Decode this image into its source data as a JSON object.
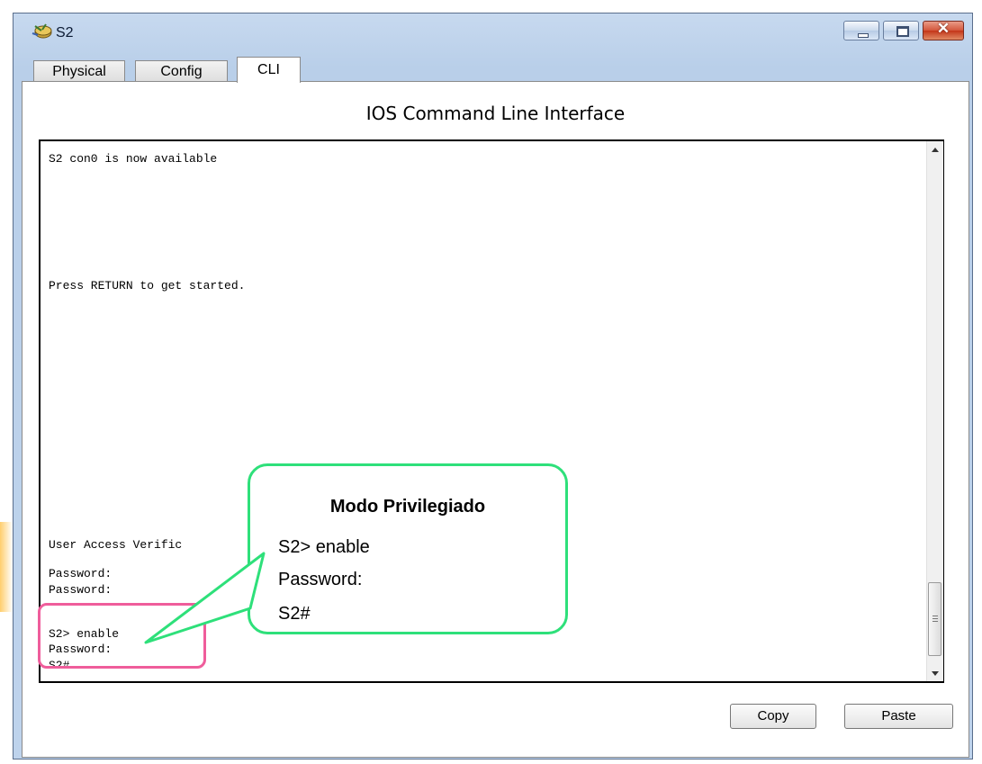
{
  "window": {
    "title": "S2",
    "icon": "router-device-icon",
    "controls": [
      "minimize-icon",
      "maximize-icon",
      "close-icon"
    ],
    "close_glyph": "✕"
  },
  "tabs": [
    {
      "label": "Physical",
      "active": false
    },
    {
      "label": "Config",
      "active": false
    },
    {
      "label": "CLI",
      "active": true
    }
  ],
  "panel": {
    "heading": "IOS Command Line Interface"
  },
  "cli": {
    "lines": [
      "S2 con0 is now available",
      "Press RETURN to get started.",
      "User Access Verific",
      "Password:",
      "Password:",
      "S2> enable",
      "Password:",
      "S2#"
    ]
  },
  "buttons": {
    "copy": "Copy",
    "paste": "Paste"
  },
  "callout": {
    "title": "Modo Privilegiado",
    "lines": [
      "S2> enable",
      "Password:",
      "S2#"
    ]
  },
  "colors": {
    "callout_border": "#2ee07a",
    "highlight_border": "#ef5d9b",
    "window_frame": "#bed3ec"
  }
}
